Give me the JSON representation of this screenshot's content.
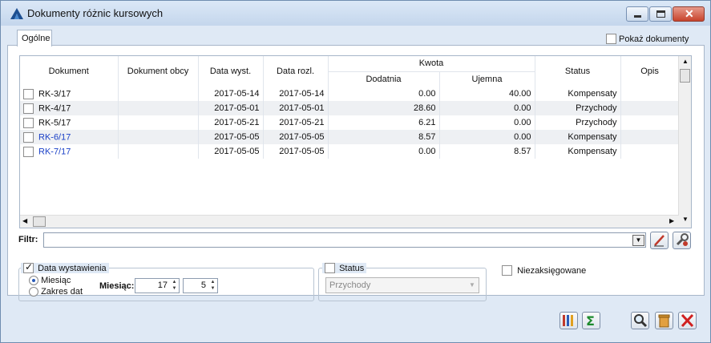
{
  "window": {
    "title": "Dokumenty różnic kursowych"
  },
  "tabs": [
    {
      "label": "Ogólne"
    }
  ],
  "show_documents": {
    "label": "Pokaż dokumenty",
    "checked": false
  },
  "table": {
    "columns": [
      "Dokument",
      "Dokument obcy",
      "Data wyst.",
      "Data rozl.",
      "Kwota",
      "Status",
      "Opis"
    ],
    "kwota_subcolumns": [
      "Dodatnia",
      "Ujemna"
    ],
    "rows": [
      {
        "dokument": "RK-3/17",
        "obcy": "",
        "data_wyst": "2017-05-14",
        "data_rozl": "2017-05-14",
        "dodatnia": "0.00",
        "ujemna": "40.00",
        "status": "Kompensaty",
        "opis": "",
        "link": false
      },
      {
        "dokument": "RK-4/17",
        "obcy": "",
        "data_wyst": "2017-05-01",
        "data_rozl": "2017-05-01",
        "dodatnia": "28.60",
        "ujemna": "0.00",
        "status": "Przychody",
        "opis": "",
        "link": false
      },
      {
        "dokument": "RK-5/17",
        "obcy": "",
        "data_wyst": "2017-05-21",
        "data_rozl": "2017-05-21",
        "dodatnia": "6.21",
        "ujemna": "0.00",
        "status": "Przychody",
        "opis": "",
        "link": false
      },
      {
        "dokument": "RK-6/17",
        "obcy": "",
        "data_wyst": "2017-05-05",
        "data_rozl": "2017-05-05",
        "dodatnia": "8.57",
        "ujemna": "0.00",
        "status": "Kompensaty",
        "opis": "",
        "link": true
      },
      {
        "dokument": "RK-7/17",
        "obcy": "",
        "data_wyst": "2017-05-05",
        "data_rozl": "2017-05-05",
        "dodatnia": "0.00",
        "ujemna": "8.57",
        "status": "Kompensaty",
        "opis": "",
        "link": true
      }
    ]
  },
  "filter": {
    "label": "Filtr:",
    "value": ""
  },
  "date_group": {
    "title": "Data wystawienia",
    "checked": true,
    "radio_month": "Miesiąc",
    "radio_range": "Zakres dat",
    "month_label": "Miesiąc:",
    "year_value": "17",
    "month_value": "5"
  },
  "status_group": {
    "title": "Status",
    "checked": false,
    "selected": "Przychody"
  },
  "unposted": {
    "label": "Niezaksięgowane",
    "checked": false
  },
  "colors": {
    "link": "#1b41c7",
    "accent": "#2a5bb8"
  }
}
